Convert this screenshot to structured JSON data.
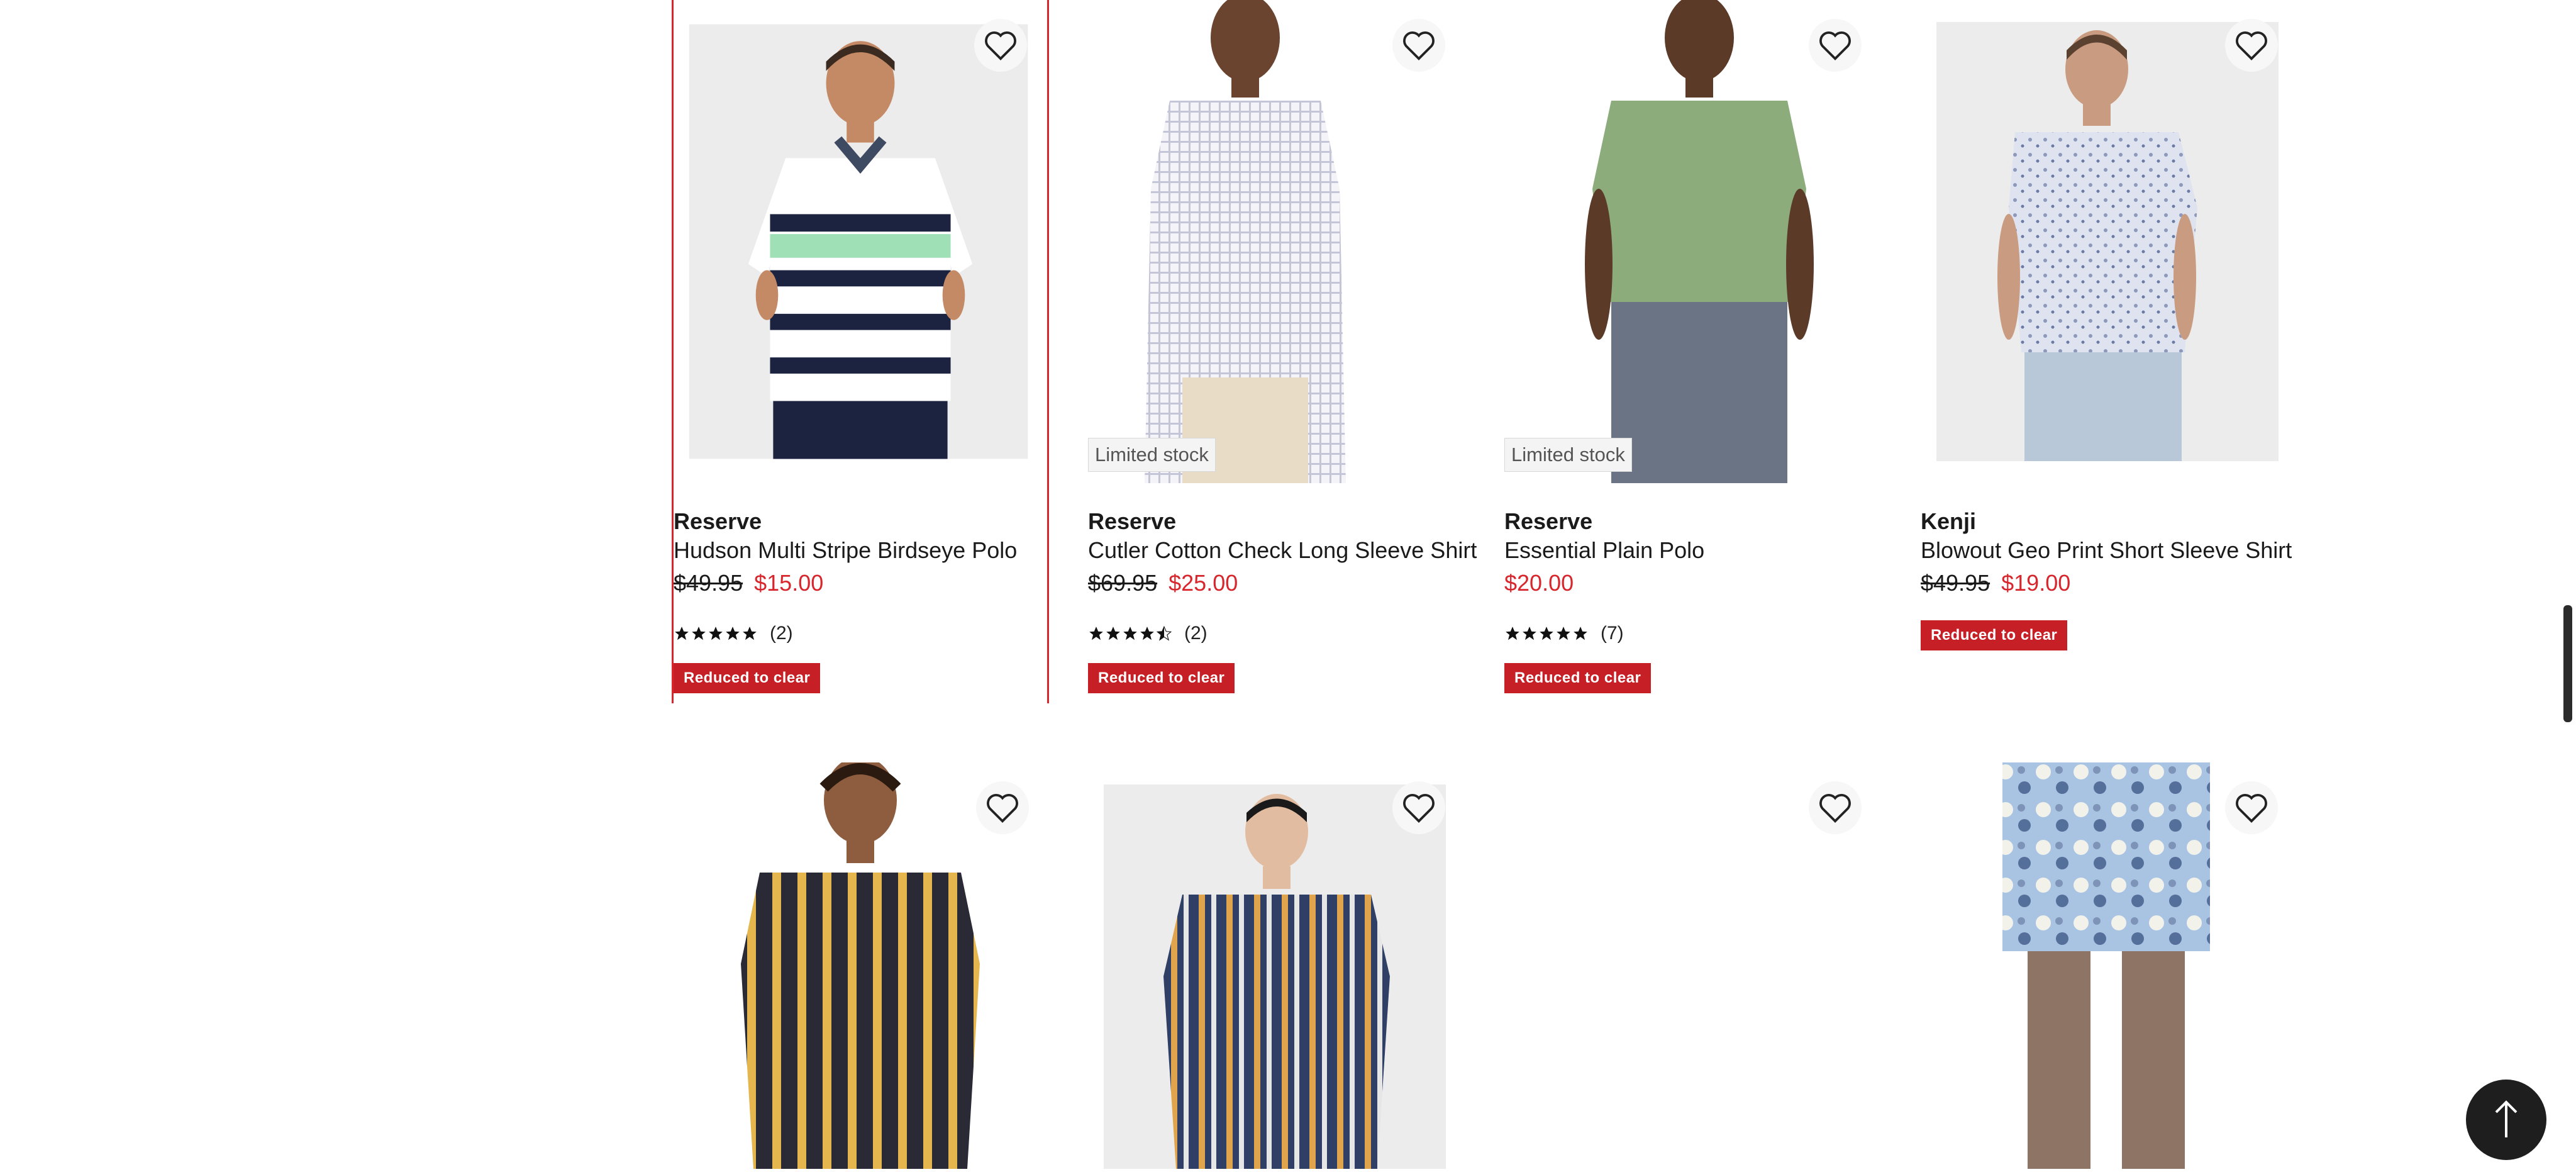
{
  "products": [
    {
      "limited_stock": "",
      "brand": "Reserve",
      "name": "Hudson Multi Stripe Birdseye Polo",
      "price_old": "$49.95",
      "price_new": "$15.00",
      "rating_count": "(2)",
      "rating": 5,
      "badge": "Reduced to clear",
      "image_icon": "striped-polo-shirt",
      "colors": {
        "stripe_a": "#9fe0b6",
        "stripe_b": "#1c2340",
        "collar": "#3e4962"
      }
    },
    {
      "limited_stock": "Limited stock",
      "brand": "Reserve",
      "name": "Cutler Cotton Check Long Sleeve Shirt",
      "price_old": "$69.95",
      "price_new": "$25.00",
      "rating_count": "(2)",
      "rating": 4.5,
      "badge": "Reduced to clear",
      "image_icon": "check-long-sleeve-shirt"
    },
    {
      "limited_stock": "Limited stock",
      "brand": "Reserve",
      "name": "Essential Plain Polo",
      "price_old": "",
      "price_new": "$20.00",
      "rating_count": "(7)",
      "rating": 5,
      "badge": "Reduced to clear",
      "image_icon": "plain-green-polo"
    },
    {
      "limited_stock": "",
      "brand": "Kenji",
      "name": "Blowout Geo Print Short Sleeve Shirt",
      "price_old": "$49.95",
      "price_new": "$19.00",
      "rating_count": "",
      "rating": 0,
      "badge": "Reduced to clear",
      "image_icon": "geo-print-shirt"
    }
  ],
  "row2_images": [
    "vertical-stripe-shirt-yellow",
    "vertical-stripe-shirt-navy",
    "blank",
    "floral-swim-shorts"
  ],
  "colors": {
    "sale_red": "#c61f26",
    "price_red": "#d8262d",
    "selected_border": "#d8262d",
    "text": "#1a1a1a"
  },
  "icons": {
    "favourite": "heart-outline-icon",
    "star": "star-icon",
    "back_to_top": "arrow-up-icon"
  }
}
